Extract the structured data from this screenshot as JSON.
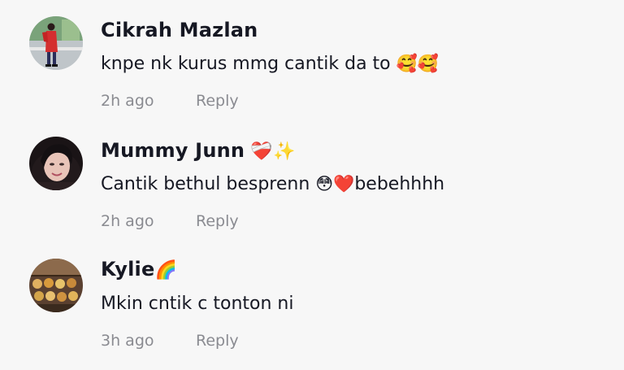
{
  "comments": [
    {
      "username": "Cikrah Mazlan",
      "username_emoji": "",
      "text_parts": [
        "knpe nk kurus mmg cantik da to ",
        "🥰🥰",
        ""
      ],
      "time": "2h ago",
      "reply_label": "Reply",
      "avatar_icon": "person-in-red-avatar"
    },
    {
      "username": "Mummy Junn",
      "username_emoji": " ❤️‍🩹✨",
      "text_parts": [
        "Cantik bethul besprenn ",
        "😳❤️",
        "bebehhhh"
      ],
      "time": "2h ago",
      "reply_label": "Reply",
      "avatar_icon": "woman-face-avatar"
    },
    {
      "username": "Kylie",
      "username_emoji": "🌈",
      "text_parts": [
        "Mkin cntik c tonton ni",
        "",
        ""
      ],
      "time": "3h ago",
      "reply_label": "Reply",
      "avatar_icon": "food-tray-avatar"
    }
  ],
  "colors": {
    "background": "#f7f7f7",
    "username": "#161823",
    "meta": "#8a8b91"
  }
}
